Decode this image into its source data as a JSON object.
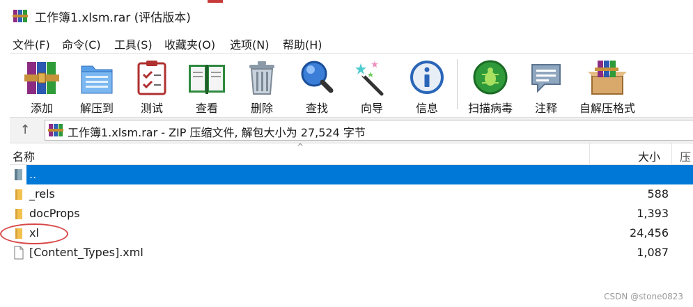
{
  "window": {
    "title": "工作簿1.xlsm.rar (评估版本)"
  },
  "menu": [
    "文件(F)",
    "命令(C)",
    "工具(S)",
    "收藏夹(O)",
    "选项(N)",
    "帮助(H)"
  ],
  "toolbar": [
    {
      "label": "添加",
      "icon": "add-archive-icon"
    },
    {
      "label": "解压到",
      "icon": "extract-to-icon"
    },
    {
      "label": "测试",
      "icon": "test-icon"
    },
    {
      "label": "查看",
      "icon": "view-icon"
    },
    {
      "label": "删除",
      "icon": "delete-icon"
    },
    {
      "label": "查找",
      "icon": "find-icon"
    },
    {
      "label": "向导",
      "icon": "wizard-icon"
    },
    {
      "label": "信息",
      "icon": "info-icon"
    },
    {
      "label": "扫描病毒",
      "icon": "virus-scan-icon"
    },
    {
      "label": "注释",
      "icon": "comment-icon"
    },
    {
      "label": "自解压格式",
      "icon": "sfx-icon"
    }
  ],
  "address": {
    "up_symbol": "↑",
    "text": "工作簿1.xlsm.rar - ZIP 压缩文件, 解包大小为 27,524 字节"
  },
  "columns": {
    "name": "名称",
    "size": "大小",
    "extra": "压",
    "sort_glyph": "^"
  },
  "files": [
    {
      "name": "..",
      "size": "",
      "type": "parent",
      "selected": true
    },
    {
      "name": "_rels",
      "size": "588",
      "type": "folder"
    },
    {
      "name": "docProps",
      "size": "1,393",
      "type": "folder"
    },
    {
      "name": "xl",
      "size": "24,456",
      "type": "folder"
    },
    {
      "name": "[Content_Types].xml",
      "size": "1,087",
      "type": "file"
    }
  ],
  "watermark": "CSDN @stone0823",
  "colors": {
    "selection": "#0078d7",
    "highlight_circle": "#d84848",
    "folder": "#f2c14e"
  }
}
